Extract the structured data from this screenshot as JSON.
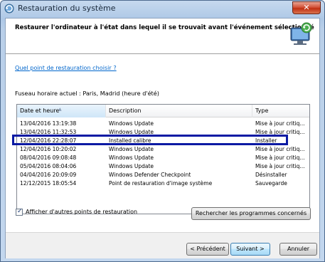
{
  "window": {
    "title": "Restauration du système",
    "close_label": "✕"
  },
  "header": {
    "text": "Restaurer l'ordinateur à l'état dans lequel il se trouvait avant l'événement sélectionné"
  },
  "link": "Quel point de restauration choisir ?",
  "timezone": "Fuseau horaire actuel : Paris, Madrid (heure d'été)",
  "table": {
    "columns": [
      "Date et heure",
      "Description",
      "Type"
    ],
    "rows": [
      {
        "date": "13/04/2016 13:19:38",
        "desc": "Windows Update",
        "type": "Mise à jour critiq..."
      },
      {
        "date": "13/04/2016 11:32:53",
        "desc": "Windows Update",
        "type": "Mise à jour critiq..."
      },
      {
        "date": "12/04/2016 22:28:07",
        "desc": "Installed calibre",
        "type": "Installer"
      },
      {
        "date": "12/04/2016 10:20:02",
        "desc": "Windows Update",
        "type": "Mise à jour critiq..."
      },
      {
        "date": "08/04/2016 09:08:48",
        "desc": "Windows Update",
        "type": "Mise à jour critiq..."
      },
      {
        "date": "05/04/2016 08:04:06",
        "desc": "Windows Update",
        "type": "Mise à jour critiq..."
      },
      {
        "date": "04/04/2016 20:09:09",
        "desc": "Windows Defender Checkpoint",
        "type": "Désinstaller"
      },
      {
        "date": "12/12/2015 18:05:54",
        "desc": "Point de restauration d'image système",
        "type": "Sauvegarde"
      }
    ],
    "selected_index": 2
  },
  "checkbox": {
    "label": "Afficher d'autres points de restauration",
    "checked": true
  },
  "buttons": {
    "search": "Rechercher les programmes concernés",
    "prev": "< Précédent",
    "next": "Suivant >",
    "cancel": "Annuler"
  },
  "colors": {
    "selection_border": "#0a1aa3",
    "link": "#0066cc"
  },
  "icons": {
    "title": "system-restore-icon",
    "header": "monitor-restore-icon"
  }
}
